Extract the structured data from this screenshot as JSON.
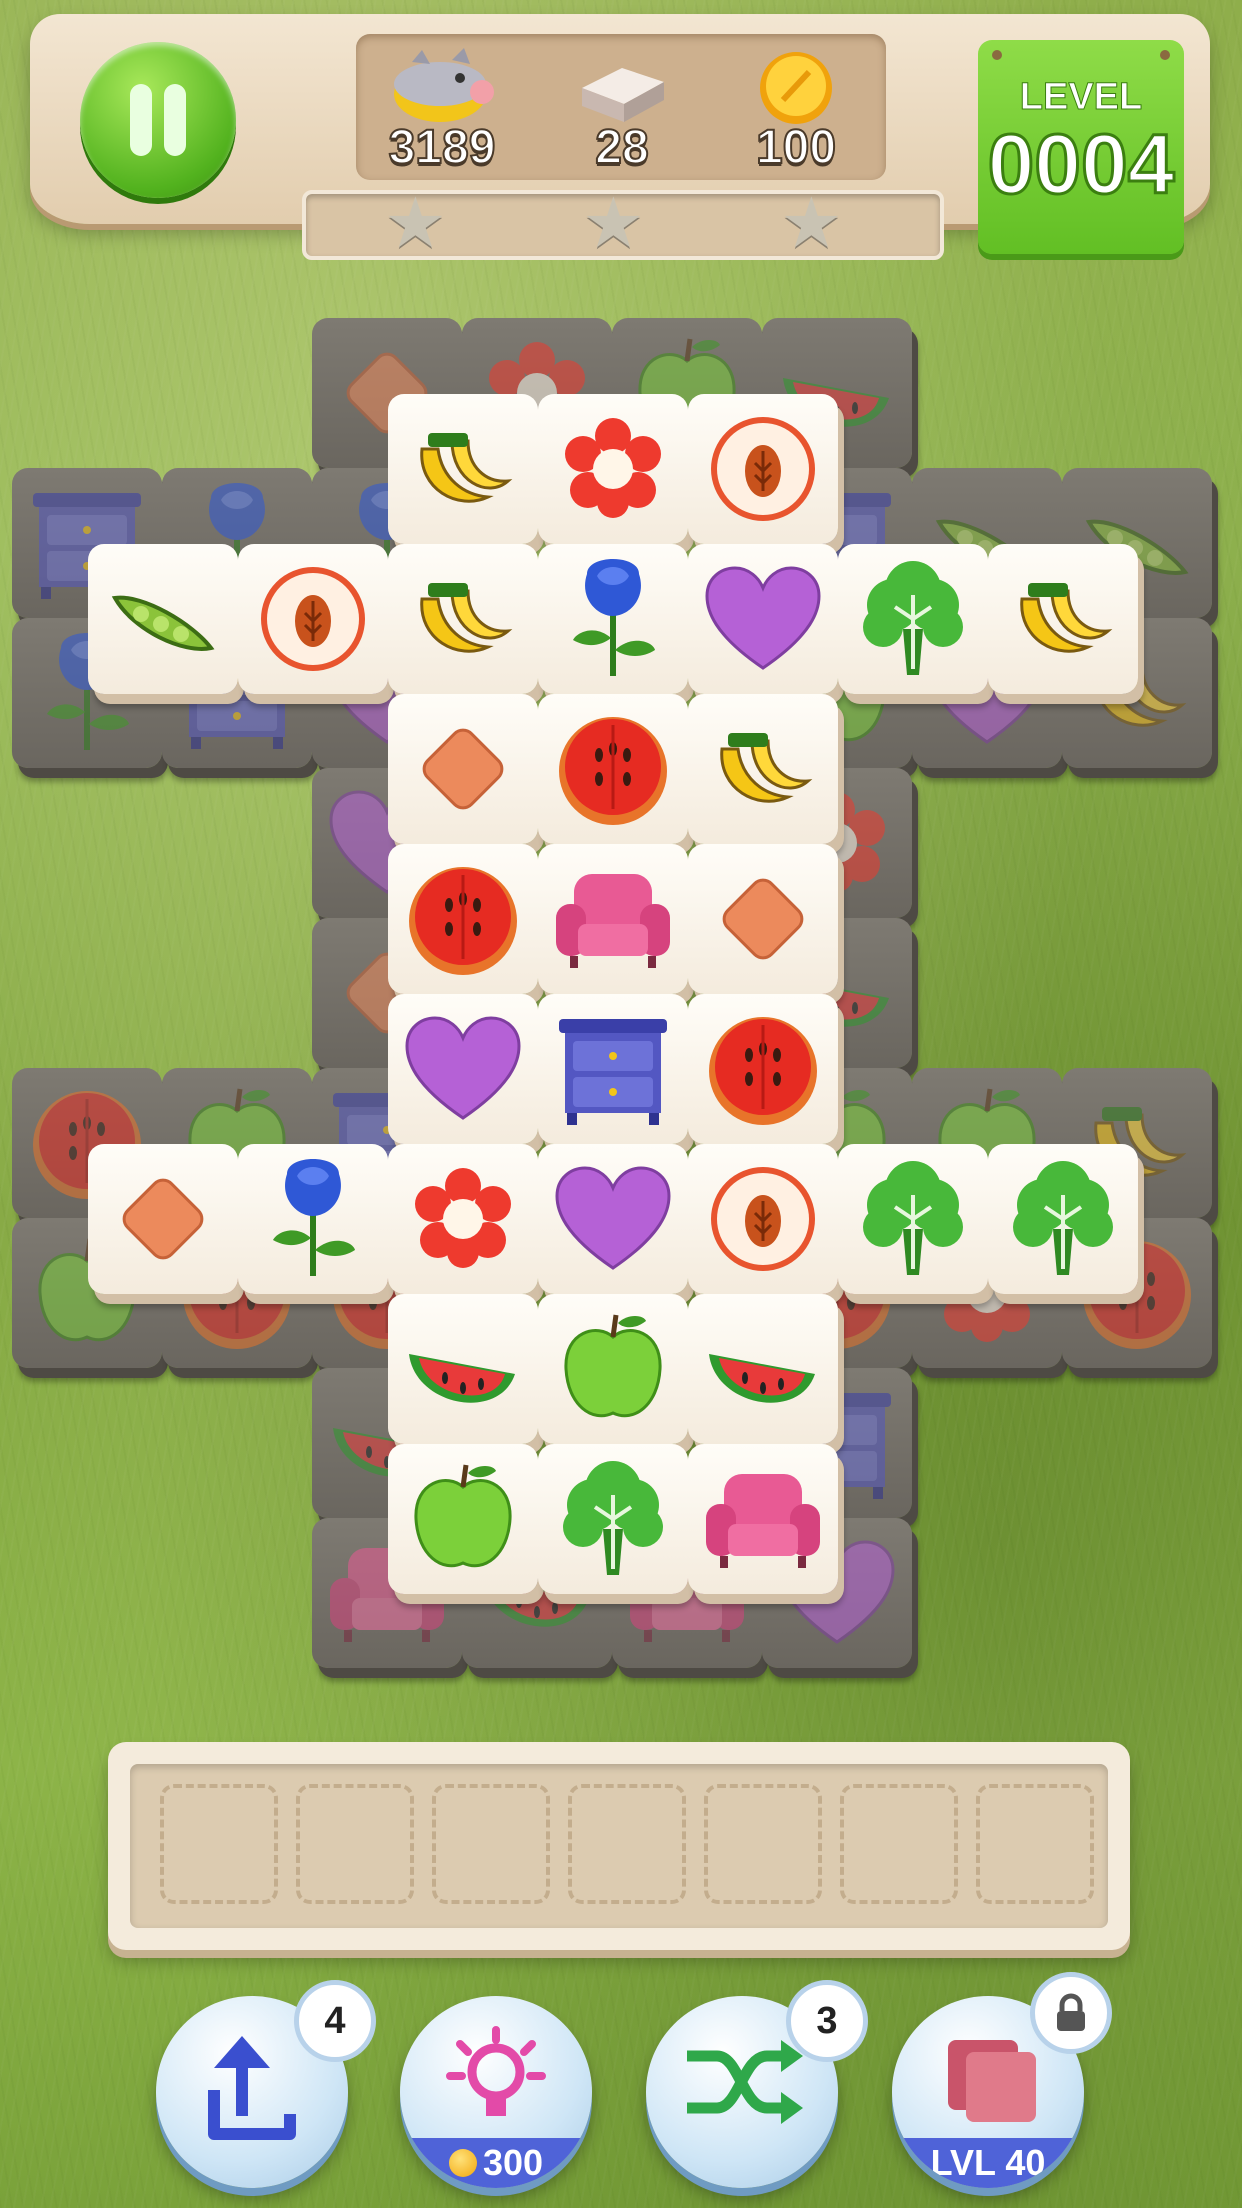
{
  "hud": {
    "piggy_value": "3189",
    "tiles_value": "28",
    "coins_value": "100",
    "level_label": "LEVEL",
    "level_number": "0004",
    "stars_earned": 0,
    "stars_total": 3
  },
  "tray": {
    "slot_count": 7,
    "filled": 0
  },
  "boosters": [
    {
      "name": "undo",
      "icon": "undo-arrow-icon",
      "count": "4"
    },
    {
      "name": "hint",
      "icon": "lightbulb-icon",
      "cost": "300"
    },
    {
      "name": "shuffle",
      "icon": "shuffle-icon",
      "count": "3"
    },
    {
      "name": "locked",
      "icon": "cards-icon",
      "unlock": "LVL 40"
    }
  ],
  "board": {
    "top_layer": [
      [
        "banana",
        "flower",
        "peach"
      ],
      [
        "peas",
        "peach",
        "banana",
        "rose",
        "heart",
        "broccoli",
        "banana"
      ],
      [
        "diamond",
        "orange",
        "banana"
      ],
      [
        "orange",
        "armchair",
        "diamond"
      ],
      [
        "heart",
        "dresser",
        "orange"
      ],
      [
        "diamond",
        "rose",
        "flower",
        "heart",
        "peach",
        "broccoli",
        "broccoli"
      ],
      [
        "watermelon",
        "apple",
        "watermelon"
      ],
      [
        "apple",
        "broccoli",
        "armchair"
      ]
    ]
  },
  "colors": {
    "accent_green": "#62bf24",
    "booster_band": "#4f63d8"
  }
}
